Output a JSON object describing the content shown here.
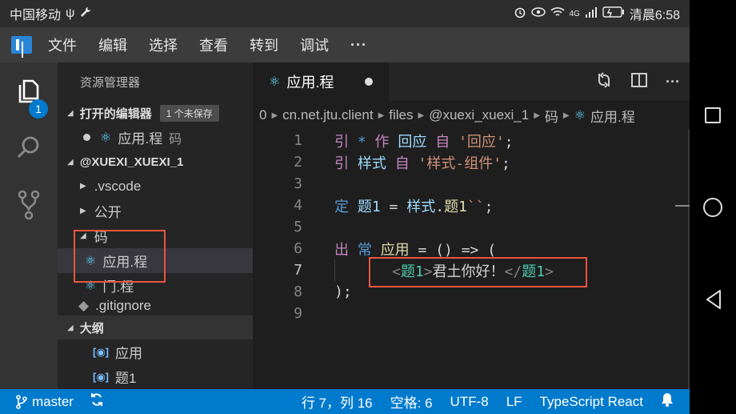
{
  "phone_status": {
    "carrier": "中国移动",
    "usb_symbol": "ψ",
    "time_label": "清晨6:58",
    "network_label": "4G"
  },
  "menubar": {
    "items": [
      "文件",
      "编辑",
      "选择",
      "查看",
      "转到",
      "调试"
    ],
    "more": "···"
  },
  "activity": {
    "explorer_badge": "1"
  },
  "sidebar": {
    "title": "资源管理器",
    "open_editors": {
      "label": "打开的编辑器",
      "unsaved_tag": "1 个未保存",
      "file": "应用.程",
      "folder": "码"
    },
    "workspace": {
      "label": "@XUEXI_XUEXI_1",
      "items": [
        ".vscode",
        "公开",
        "码",
        "应用.程",
        "门.程",
        ".gitignore"
      ]
    },
    "outline": {
      "label": "大纲",
      "items": [
        "应用",
        "题1"
      ]
    }
  },
  "tab": {
    "label": "应用.程"
  },
  "breadcrumb": [
    "0",
    "cn.net.jtu.client",
    "files",
    "@xuexi_xuexi_1",
    "码",
    "应用.程"
  ],
  "code": {
    "line_numbers": [
      "1",
      "2",
      "3",
      "4",
      "5",
      "6",
      "7",
      "8",
      "9"
    ],
    "l1": {
      "k1": "引",
      "star": "*",
      "k2": "作",
      "name": "回应",
      "k3": "自",
      "src": "'回应'",
      "end": ";"
    },
    "l2": {
      "k1": "引",
      "name": "样式",
      "k3": "自",
      "src": "'样式-组件'",
      "end": ";"
    },
    "l4": {
      "k1": "定",
      "name": "题1",
      "eq": "=",
      "obj": "样式",
      "dot": ".",
      "prop": "题1",
      "tpl": "``",
      "end": ";"
    },
    "l6": {
      "k1": "出",
      "k2": "常",
      "name": "应用",
      "rest": "= () => ("
    },
    "l7": {
      "open_lt": "<",
      "open_tag": "题1",
      "open_gt": ">",
      "text": "君土你好！",
      "close_lt": "</",
      "close_tag": "题1",
      "close_gt": ">"
    },
    "l8": {
      "text": ");"
    }
  },
  "statusbar": {
    "branch": "master",
    "position": "行 7，列 16",
    "spaces": "空格: 6",
    "encoding": "UTF-8",
    "eol": "LF",
    "language": "TypeScript React"
  },
  "colors": {
    "accent": "#007acc",
    "highlight": "#e8553e",
    "react": "#61dafb"
  }
}
